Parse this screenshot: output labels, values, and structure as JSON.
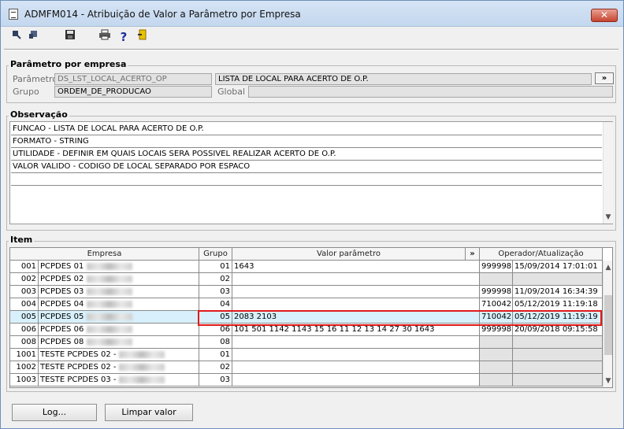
{
  "window": {
    "title": "ADMFM014 - Atribuição de Valor a Parâmetro por Empresa",
    "close_label": "✕"
  },
  "toolbar": {
    "icons": [
      "arrow-back-icon",
      "arrow-next-icon",
      "save-icon",
      "print-icon",
      "help-icon",
      "exit-icon"
    ]
  },
  "parametro": {
    "section_title": "Parâmetro por empresa",
    "parametro_label": "Parâmetro",
    "parametro_value": "DS_LST_LOCAL_ACERTO_OP",
    "descricao_value": "LISTA DE  LOCAL PARA ACERTO DE O.P.",
    "expand_label": "»",
    "grupo_label": "Grupo",
    "grupo_value": "ORDEM_DE_PRODUCAO",
    "global_label": "Global",
    "global_value": ""
  },
  "observacao": {
    "section_title": "Observação",
    "lines": [
      "FUNCAO - LISTA DE  LOCAL PARA ACERTO DE O.P.",
      "FORMATO - STRING",
      "UTILIDADE -  DEFINIR EM QUAIS LOCAIS SERA POSSIVEL REALIZAR ACERTO DE O.P.",
      "VALOR VALIDO - CODIGO DE LOCAL SEPARADO POR ESPACO",
      "",
      "",
      "",
      ""
    ]
  },
  "item": {
    "section_title": "Item",
    "columns": {
      "empresa": "Empresa",
      "grupo": "Grupo",
      "valor": "Valor parâmetro",
      "expand": "»",
      "operador": "Operador/Atualização"
    },
    "rows": [
      {
        "code": "001",
        "empresa": "PCPDES 01",
        "grupo": "01",
        "valor": "1643",
        "operador": "999998",
        "atualizacao": "15/09/2014 17:01:01"
      },
      {
        "code": "002",
        "empresa": "PCPDES 02",
        "grupo": "02",
        "valor": "",
        "operador": "",
        "atualizacao": ""
      },
      {
        "code": "003",
        "empresa": "PCPDES 03",
        "grupo": "03",
        "valor": "",
        "operador": "999998",
        "atualizacao": "11/09/2014 16:34:39"
      },
      {
        "code": "004",
        "empresa": "PCPDES 04",
        "grupo": "04",
        "valor": "",
        "operador": "710042",
        "atualizacao": "05/12/2019 11:19:18"
      },
      {
        "code": "005",
        "empresa": "PCPDES 05",
        "grupo": "05",
        "valor": "2083 2103",
        "operador": "710042",
        "atualizacao": "05/12/2019 11:19:19"
      },
      {
        "code": "006",
        "empresa": "PCPDES 06",
        "grupo": "06",
        "valor": "101 501 1142 1143 15 16 11 12 13 14 27 30 1643",
        "operador": "999998",
        "atualizacao": "20/09/2018 09:15:58"
      },
      {
        "code": "008",
        "empresa": "PCPDES 08",
        "grupo": "08",
        "valor": "",
        "operador": "",
        "atualizacao": ""
      },
      {
        "code": "1001",
        "empresa": "TESTE PCPDES 02 -",
        "grupo": "01",
        "valor": "",
        "operador": "",
        "atualizacao": ""
      },
      {
        "code": "1002",
        "empresa": "TESTE PCPDES 02 -",
        "grupo": "02",
        "valor": "",
        "operador": "",
        "atualizacao": ""
      },
      {
        "code": "1003",
        "empresa": "TESTE PCPDES 03 -",
        "grupo": "03",
        "valor": "",
        "operador": "",
        "atualizacao": ""
      }
    ]
  },
  "buttons": {
    "log": "Log...",
    "limpar": "Limpar valor"
  },
  "colors": {
    "selected_row": "#d8f0fb",
    "highlight_border": "#e01a1a"
  }
}
